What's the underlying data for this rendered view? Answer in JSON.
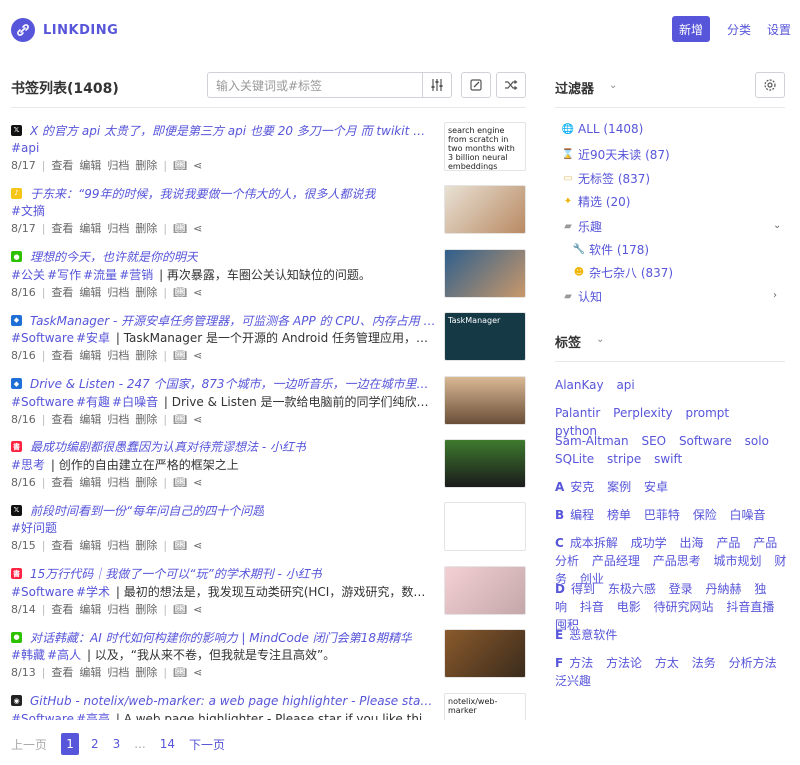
{
  "app": {
    "name": "LINKDING"
  },
  "nav": {
    "add_label": "新增",
    "categories_label": "分类",
    "settings_label": "设置"
  },
  "bookmarks": {
    "title": "书签列表(1408)",
    "search_placeholder": "输入关键词或#标签",
    "items": [
      {
        "favicon": "x",
        "title": "X 的官方 api 太贵了，即便是第三方 api 也要 20 多刀一个月 而 twikit 是一个...",
        "tags": [
          "#api"
        ],
        "desc": "",
        "date": "8/17",
        "thumb_text": "search engine from scratch in two months with 3 billion neural embeddings"
      },
      {
        "favicon": "note",
        "title": "于东来：“99年的时候，我说我要做一个伟大的人，很多人都说我",
        "tags": [
          "#文摘"
        ],
        "desc": "",
        "date": "8/17",
        "thumb_text": ""
      },
      {
        "favicon": "wechat",
        "title": "理想的今天，也许就是你的明天",
        "tags": [
          "#公关",
          "#写作",
          "#流量",
          "#营销"
        ],
        "desc": "| 再次暴露，车圈公关认知缺位的问题。",
        "date": "8/16",
        "thumb_text": ""
      },
      {
        "favicon": "drop",
        "title": "TaskManager - 开源安卓任务管理器，可监测各 APP 的 CPU、内存占用 - 小...",
        "tags": [
          "#Software",
          "#安卓"
        ],
        "desc": "| TaskManager 是一个开源的 Android 任务管理应用，受 GNO...",
        "date": "8/16",
        "thumb_text": "TaskManager"
      },
      {
        "favicon": "drop",
        "title": "Drive & Listen - 247 个国家，873个城市，一边听音乐，一边在城市里瞎转悠...",
        "tags": [
          "#Software",
          "#有趣",
          "#白噪音"
        ],
        "desc": "| Drive & Listen 是一款给电脑前的同学们纯欣赏使用的...",
        "date": "8/16",
        "thumb_text": ""
      },
      {
        "favicon": "xhs",
        "title": "最成功编剧都很愚蠢因为认真对待荒谬想法 - 小红书",
        "tags": [
          "#思考"
        ],
        "desc": "| 创作的自由建立在严格的框架之上",
        "date": "8/16",
        "thumb_text": ""
      },
      {
        "favicon": "x",
        "title": "前段时间看到一份“每年问自己的四十个问题",
        "tags": [
          "#好问题"
        ],
        "desc": "",
        "date": "8/15",
        "thumb_text": ""
      },
      {
        "favicon": "xhs",
        "title": "15万行代码｜我做了一个可以“玩”的学术期刊 - 小红书",
        "tags": [
          "#Software",
          "#学术"
        ],
        "desc": "| 最初的想法是，我发现互动类研究(HCI，游戏研究，数字媒体)...",
        "date": "8/14",
        "thumb_text": ""
      },
      {
        "favicon": "wechat",
        "title": "对话韩藏：AI 时代如何构建你的影响力 | MindCode 闭门会第18期精华",
        "tags": [
          "#韩藏",
          "#高人"
        ],
        "desc": "| 以及，“我从来不卷，但我就是专注且高效”。",
        "date": "8/13",
        "thumb_text": ""
      },
      {
        "favicon": "github",
        "title": "GitHub - notelix/web-marker: a web page highlighter - Please star if you l...",
        "tags": [
          "#Software",
          "#高亮"
        ],
        "desc": "| A web page highlighter - Please star if you like this project",
        "date": "8/13",
        "thumb_text": "notelix/web-marker"
      }
    ],
    "actions": {
      "view": "查看",
      "edit": "编辑",
      "archive": "归档",
      "delete": "删除"
    }
  },
  "pagination": {
    "prev": "上一页",
    "pages": [
      "1",
      "2",
      "3",
      "...",
      "14"
    ],
    "next": "下一页"
  },
  "filters": {
    "title": "过滤器",
    "items": [
      {
        "icon": "globe",
        "label": "ALL (1408)"
      },
      {
        "icon": "hourglass",
        "label": "近90天未读 (87)"
      },
      {
        "icon": "label",
        "label": "无标签 (837)"
      },
      {
        "icon": "sparkle",
        "label": "精选 (20)"
      },
      {
        "icon": "folder",
        "label": "乐趣"
      },
      {
        "icon": "wrench",
        "label": "软件 (178)"
      },
      {
        "icon": "smile",
        "label": "杂七杂八 (837)"
      },
      {
        "icon": "folder",
        "label": "认知"
      }
    ]
  },
  "tags": {
    "title": "标签",
    "groups": [
      {
        "letter": "",
        "tags": [
          "AlanKay",
          "api"
        ]
      },
      {
        "letter": "",
        "tags": [
          "Palantir",
          "Perplexity",
          "prompt",
          "python"
        ]
      },
      {
        "letter": "",
        "tags": [
          "Sam-Altman",
          "SEO",
          "Software",
          "solo",
          "SQLite",
          "stripe",
          "swift"
        ]
      },
      {
        "letter": "A",
        "tags": [
          "安克",
          "案例",
          "安卓"
        ]
      },
      {
        "letter": "B",
        "tags": [
          "编程",
          "榜单",
          "巴菲特",
          "保险",
          "白噪音"
        ]
      },
      {
        "letter": "C",
        "tags": [
          "成本拆解",
          "成功学",
          "出海",
          "产品",
          "产品分析",
          "产品经理",
          "产品思考",
          "城市规划",
          "财务",
          "创业"
        ]
      },
      {
        "letter": "D",
        "tags": [
          "得到",
          "东极六感",
          "登录",
          "丹納赫",
          "独响",
          "抖音",
          "电影",
          "待研究网站",
          "抖音直播",
          "囤积"
        ]
      },
      {
        "letter": "E",
        "tags": [
          "恶意软件"
        ]
      },
      {
        "letter": "F",
        "tags": [
          "方法",
          "方法论",
          "方太",
          "法务",
          "分析方法",
          "泛兴趣"
        ]
      }
    ]
  }
}
